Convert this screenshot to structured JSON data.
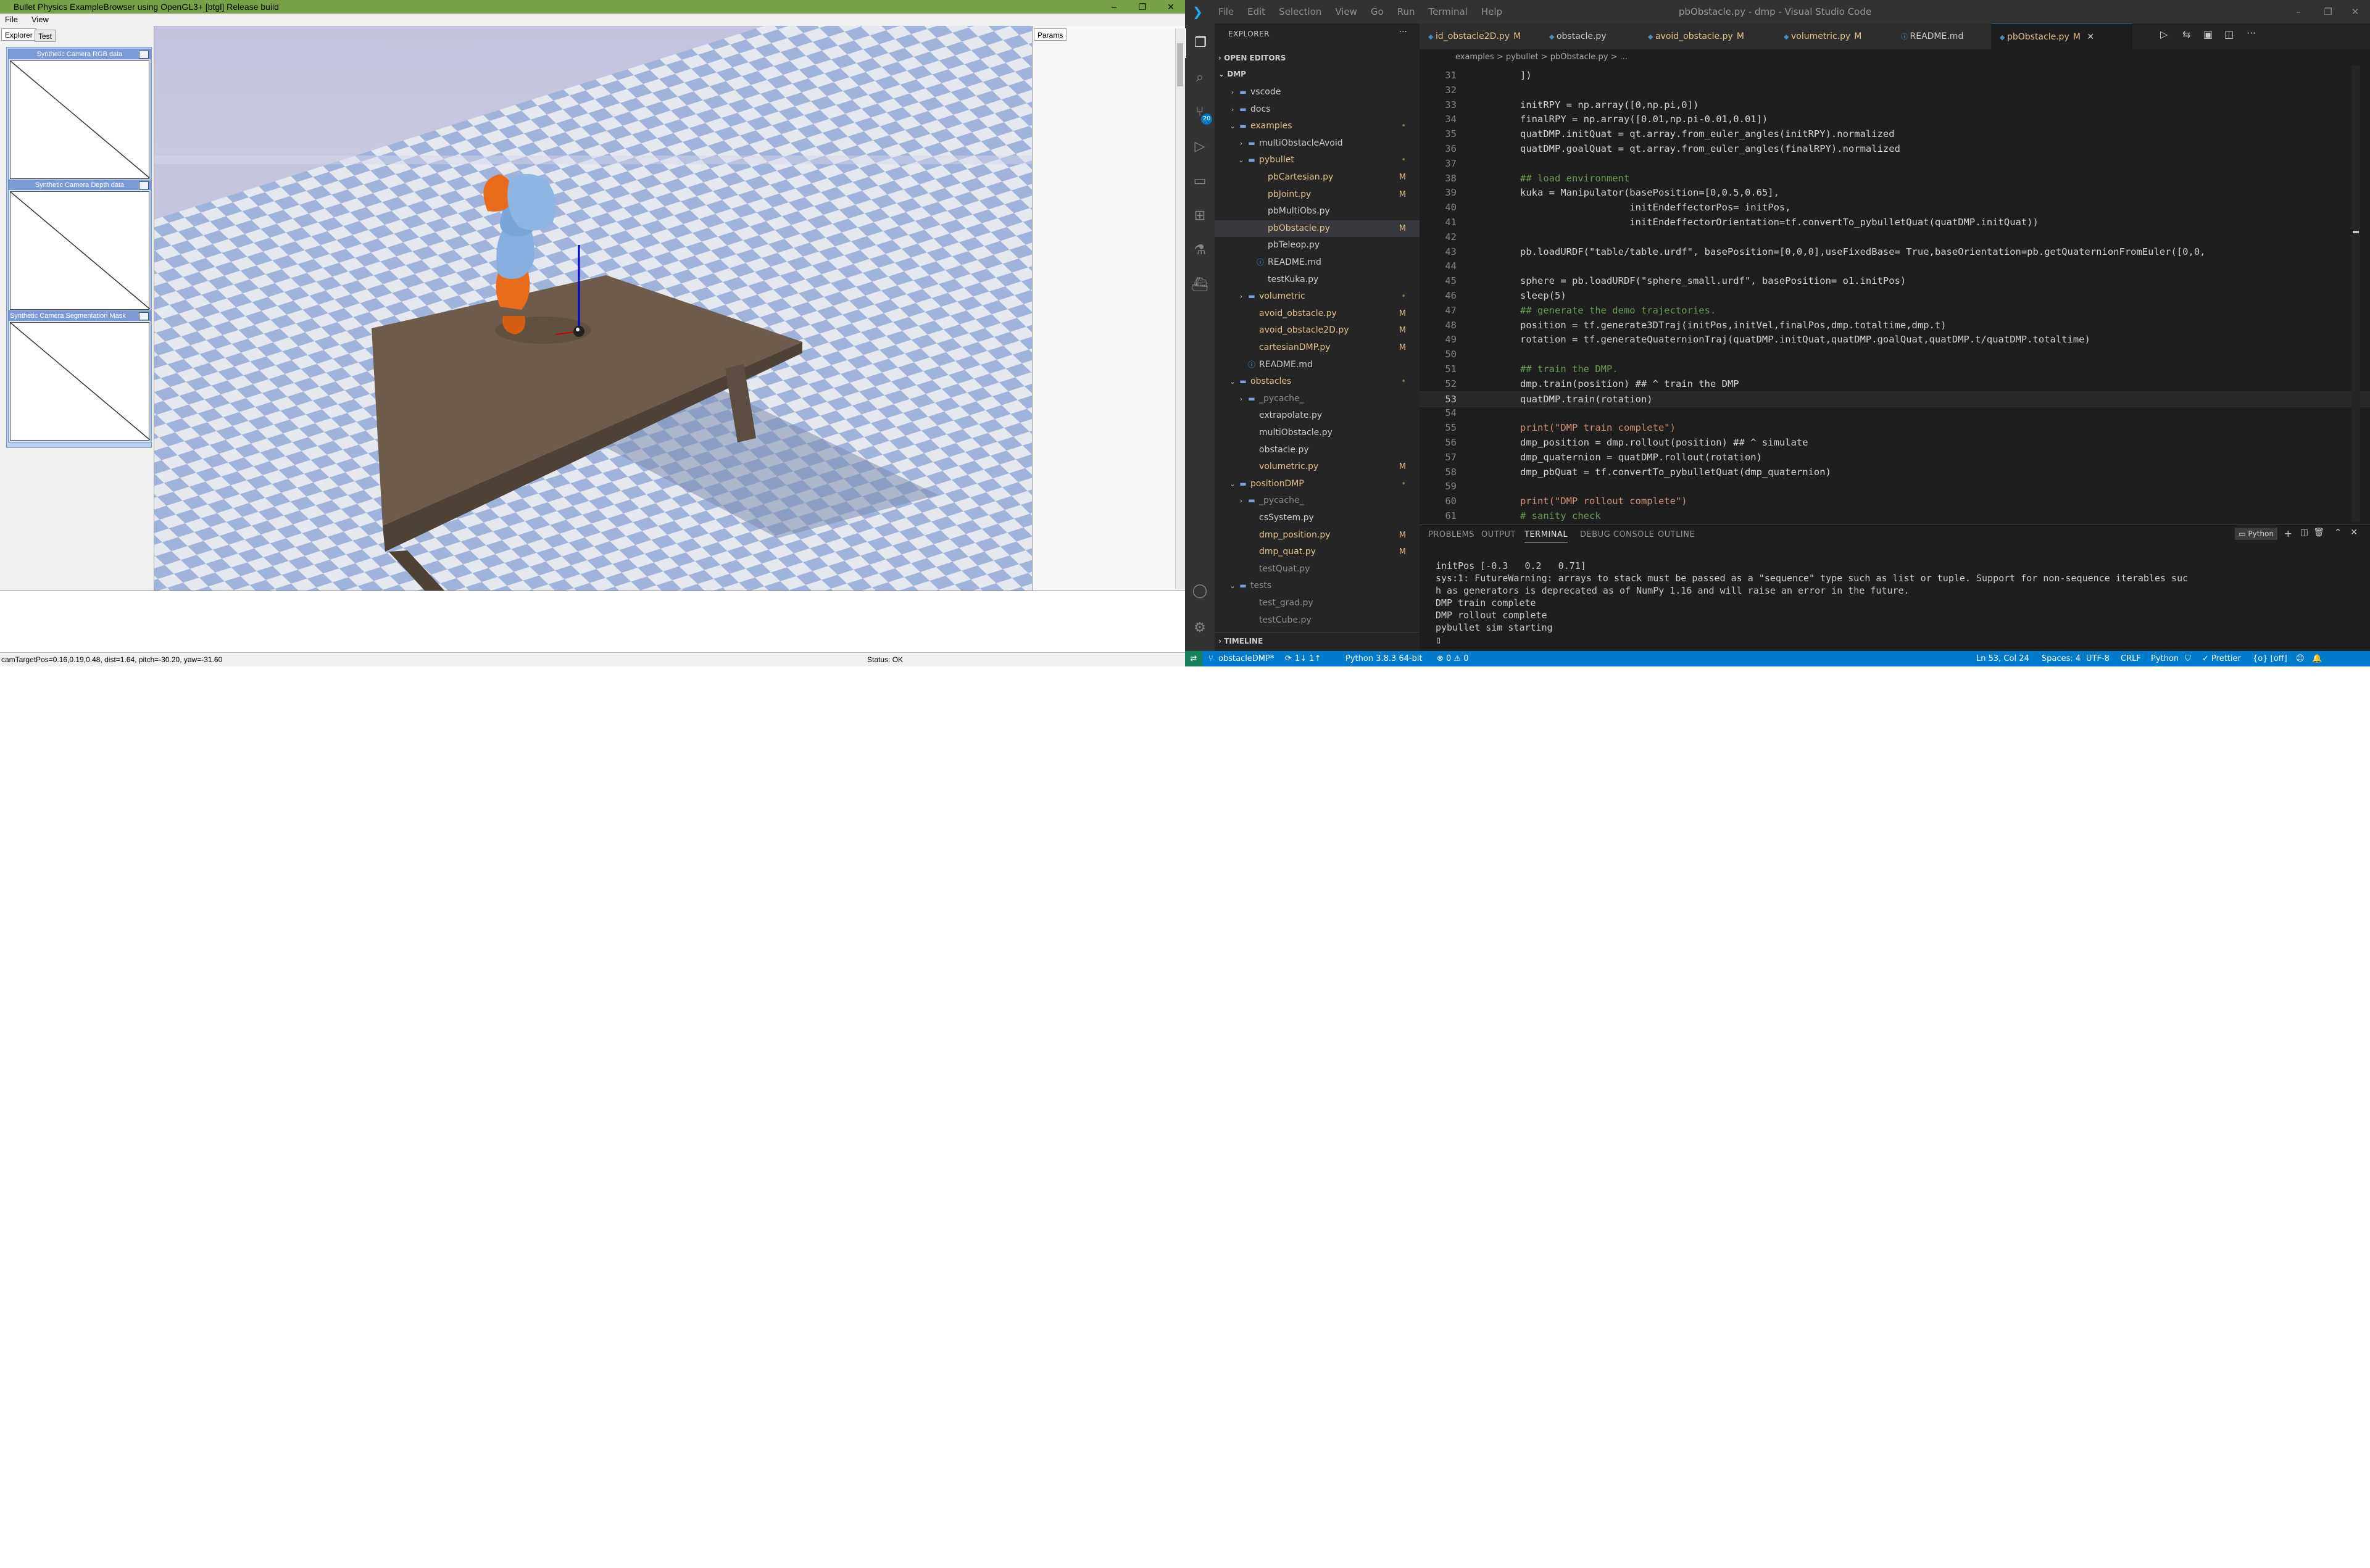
{
  "bullet": {
    "title": "Bullet Physics ExampleBrowser using OpenGL3+ [btgl] Release build",
    "window_controls": [
      "–",
      "❐",
      "✕"
    ],
    "menu": [
      "File",
      "View"
    ],
    "left_tabs": [
      "Explorer",
      "Test"
    ],
    "camera_panels": [
      {
        "title": "Synthetic Camera RGB data"
      },
      {
        "title": "Synthetic Camera Depth data"
      },
      {
        "title": "Synthetic Camera Segmentation Mask"
      }
    ],
    "right_tab": "Params",
    "status_left": "camTargetPos=0.16,0.19,0.48, dist=1.64, pitch=-30.20, yaw=-31.60",
    "status_right": "Status: OK"
  },
  "vscode": {
    "title": "pbObstacle.py - dmp - Visual Studio Code",
    "menu": [
      "File",
      "Edit",
      "Selection",
      "View",
      "Go",
      "Run",
      "Terminal",
      "Help"
    ],
    "activity_icons": [
      "explorer-icon",
      "search-icon",
      "source-control-icon",
      "run-debug-icon",
      "remote-explorer-icon",
      "extensions-icon",
      "testing-icon",
      "docker-icon",
      "account-icon",
      "settings-gear-icon"
    ],
    "scm_badge": "20",
    "explorer": {
      "header": "EXPLORER",
      "more": "···",
      "open_editors": "OPEN EDITORS",
      "root": "DMP",
      "timeline": "TIMELINE",
      "tree": [
        {
          "label": "vscode",
          "depth": 1,
          "folder": true,
          "open": false,
          "color": "#cccccc"
        },
        {
          "label": "docs",
          "depth": 1,
          "folder": true,
          "open": false,
          "color": "#cccccc"
        },
        {
          "label": "examples",
          "depth": 1,
          "folder": true,
          "open": true,
          "color": "#e2c08d",
          "mark": "•"
        },
        {
          "label": "multiObstacleAvoid",
          "depth": 2,
          "folder": true,
          "open": false,
          "color": "#cccccc"
        },
        {
          "label": "pybullet",
          "depth": 2,
          "folder": true,
          "open": true,
          "color": "#e2c08d",
          "mark": "•"
        },
        {
          "label": "pbCartesian.py",
          "depth": 3,
          "color": "#e2c08d",
          "mark": "M"
        },
        {
          "label": "pbJoint.py",
          "depth": 3,
          "color": "#e2c08d",
          "mark": "M"
        },
        {
          "label": "pbMultiObs.py",
          "depth": 3,
          "color": "#cccccc"
        },
        {
          "label": "pbObstacle.py",
          "depth": 3,
          "color": "#e2c08d",
          "mark": "M",
          "selected": true
        },
        {
          "label": "pbTeleop.py",
          "depth": 3,
          "color": "#cccccc"
        },
        {
          "label": "README.md",
          "depth": 3,
          "color": "#cccccc",
          "info": true
        },
        {
          "label": "testKuka.py",
          "depth": 3,
          "color": "#cccccc"
        },
        {
          "label": "volumetric",
          "depth": 2,
          "folder": true,
          "open": false,
          "color": "#e2c08d",
          "mark": "•"
        },
        {
          "label": "avoid_obstacle.py",
          "depth": 2,
          "color": "#e2c08d",
          "mark": "M"
        },
        {
          "label": "avoid_obstacle2D.py",
          "depth": 2,
          "color": "#e2c08d",
          "mark": "M"
        },
        {
          "label": "cartesianDMP.py",
          "depth": 2,
          "color": "#e2c08d",
          "mark": "M"
        },
        {
          "label": "README.md",
          "depth": 2,
          "color": "#cccccc",
          "info": true
        },
        {
          "label": "obstacles",
          "depth": 1,
          "folder": true,
          "open": true,
          "color": "#e2c08d",
          "mark": "•"
        },
        {
          "label": "_pycache_",
          "depth": 2,
          "folder": true,
          "open": false,
          "color": "#8c8c8c"
        },
        {
          "label": "extrapolate.py",
          "depth": 2,
          "color": "#cccccc"
        },
        {
          "label": "multiObstacle.py",
          "depth": 2,
          "color": "#cccccc"
        },
        {
          "label": "obstacle.py",
          "depth": 2,
          "color": "#cccccc"
        },
        {
          "label": "volumetric.py",
          "depth": 2,
          "color": "#e2c08d",
          "mark": "M"
        },
        {
          "label": "positionDMP",
          "depth": 1,
          "folder": true,
          "open": true,
          "color": "#e2c08d",
          "mark": "•"
        },
        {
          "label": "_pycache_",
          "depth": 2,
          "folder": true,
          "open": false,
          "color": "#8c8c8c"
        },
        {
          "label": "csSystem.py",
          "depth": 2,
          "color": "#cccccc"
        },
        {
          "label": "dmp_position.py",
          "depth": 2,
          "color": "#e2c08d",
          "mark": "M"
        },
        {
          "label": "dmp_quat.py",
          "depth": 2,
          "color": "#e2c08d",
          "mark": "M"
        },
        {
          "label": "testQuat.py",
          "depth": 2,
          "color": "#8c8c8c"
        },
        {
          "label": "tests",
          "depth": 1,
          "folder": true,
          "open": true,
          "color": "#8c8c8c"
        },
        {
          "label": "test_grad.py",
          "depth": 2,
          "color": "#8c8c8c"
        },
        {
          "label": "testCube.py",
          "depth": 2,
          "color": "#8c8c8c"
        }
      ]
    },
    "tabs": [
      {
        "label": "id_obstacle2D.py",
        "mark": "M"
      },
      {
        "label": "obstacle.py",
        "mark": ""
      },
      {
        "label": "avoid_obstacle.py",
        "mark": "M"
      },
      {
        "label": "volumetric.py",
        "mark": "M"
      },
      {
        "label": "README.md",
        "mark": ""
      },
      {
        "label": "pbObstacle.py",
        "mark": "M",
        "active": true
      }
    ],
    "breadcrumb": "examples > pybullet > pbObstacle.py > ...",
    "code": [
      {
        "n": "31",
        "t": "])"
      },
      {
        "n": "32",
        "t": ""
      },
      {
        "n": "33",
        "t": "initRPY = np.array([0,np.pi,0])"
      },
      {
        "n": "34",
        "t": "finalRPY = np.array([0.01,np.pi-0.01,0.01])"
      },
      {
        "n": "35",
        "t": "quatDMP.initQuat = qt.array.from_euler_angles(initRPY).normalized"
      },
      {
        "n": "36",
        "t": "quatDMP.goalQuat = qt.array.from_euler_angles(finalRPY).normalized"
      },
      {
        "n": "37",
        "t": ""
      },
      {
        "n": "38",
        "t": "## load environment"
      },
      {
        "n": "39",
        "t": "kuka = Manipulator(basePosition=[0,0.5,0.65],"
      },
      {
        "n": "40",
        "t": "                   initEndeffectorPos= initPos,"
      },
      {
        "n": "41",
        "t": "                   initEndeffectorOrientation=tf.convertTo_pybulletQuat(quatDMP.initQuat))"
      },
      {
        "n": "42",
        "t": ""
      },
      {
        "n": "43",
        "t": "pb.loadURDF(\"table/table.urdf\", basePosition=[0,0,0],useFixedBase= True,baseOrientation=pb.getQuaternionFromEuler([0,0,"
      },
      {
        "n": "44",
        "t": ""
      },
      {
        "n": "45",
        "t": "sphere = pb.loadURDF(\"sphere_small.urdf\", basePosition= o1.initPos)"
      },
      {
        "n": "46",
        "t": "sleep(5)"
      },
      {
        "n": "47",
        "t": "## generate the demo trajectories."
      },
      {
        "n": "48",
        "t": "position = tf.generate3DTraj(initPos,initVel,finalPos,dmp.totaltime,dmp.t)"
      },
      {
        "n": "49",
        "t": "rotation = tf.generateQuaternionTraj(quatDMP.initQuat,quatDMP.goalQuat,quatDMP.t/quatDMP.totaltime)"
      },
      {
        "n": "50",
        "t": ""
      },
      {
        "n": "51",
        "t": "## train the DMP."
      },
      {
        "n": "52",
        "t": "dmp.train(position) ## ^ train the DMP"
      },
      {
        "n": "53",
        "t": "quatDMP.train(rotation)",
        "current": true
      },
      {
        "n": "54",
        "t": ""
      },
      {
        "n": "55",
        "t": "print(\"DMP train complete\")"
      },
      {
        "n": "56",
        "t": "dmp_position = dmp.rollout(position) ## ^ simulate"
      },
      {
        "n": "57",
        "t": "dmp_quaternion = quatDMP.rollout(rotation)"
      },
      {
        "n": "58",
        "t": "dmp_pbQuat = tf.convertTo_pybulletQuat(dmp_quaternion)"
      },
      {
        "n": "59",
        "t": ""
      },
      {
        "n": "60",
        "t": "print(\"DMP rollout complete\")"
      },
      {
        "n": "61",
        "t": "# sanity check"
      }
    ],
    "panel_tabs": [
      "PROBLEMS",
      "OUTPUT",
      "TERMINAL",
      "DEBUG CONSOLE",
      "OUTLINE"
    ],
    "panel_active": "TERMINAL",
    "terminal_select": "Python",
    "terminal": [
      "initPos [-0.3   0.2   0.71]",
      "sys:1: FutureWarning: arrays to stack must be passed as a \"sequence\" type such as list or tuple. Support for non-sequence iterables suc",
      "h as generators is deprecated as of NumPy 1.16 and will raise an error in the future.",
      "DMP train complete",
      "DMP rollout complete",
      "pybullet sim starting",
      "▯"
    ],
    "status": {
      "branch": "obstacleDMP*",
      "sync": "1↓ 1↑",
      "interpreter": "Python 3.8.3 64-bit",
      "problems": "⊗ 0 ⚠ 0",
      "position": "Ln 53, Col 24",
      "spaces": "Spaces: 4",
      "encoding": "UTF-8",
      "eol": "CRLF",
      "language": "Python",
      "prettier": "✓ Prettier",
      "golive": "{o} [off]"
    }
  }
}
